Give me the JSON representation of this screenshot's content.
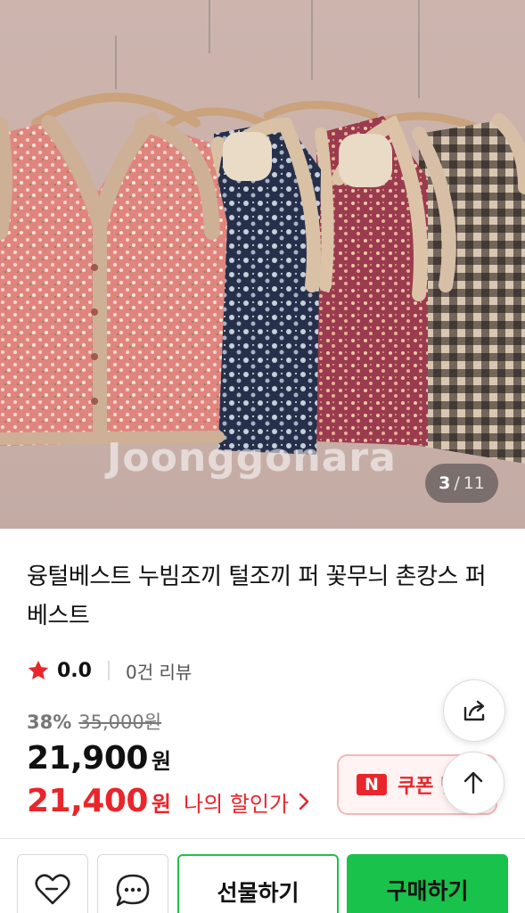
{
  "gallery": {
    "watermark": "Joonggonara",
    "current": "3",
    "separator": "/",
    "total": "11"
  },
  "product": {
    "title": "융털베스트 누빔조끼 털조끼 퍼 꽃무늬 촌캉스 퍼베스트",
    "rating": "0.0",
    "review_count": "0건 리뷰",
    "discount_rate": "38%",
    "original_price": "35,000원",
    "price": "21,900",
    "price_unit": "원",
    "my_price": "21,400",
    "my_price_unit": "원",
    "my_discount_label": "나의 할인가"
  },
  "coupon": {
    "logo": "N",
    "label": "쿠폰 받"
  },
  "actions": {
    "gift_label": "선물하기",
    "buy_label": "구매하기"
  },
  "icons": {
    "star": "star-icon",
    "share": "share-icon",
    "top": "arrow-up-icon",
    "wish": "heart-icon",
    "chat": "chat-icon",
    "chevron": "chevron-right-icon"
  },
  "colors": {
    "accent_red": "#e8262b",
    "buy_green": "#19c24a",
    "gift_border": "#1fc14a"
  }
}
